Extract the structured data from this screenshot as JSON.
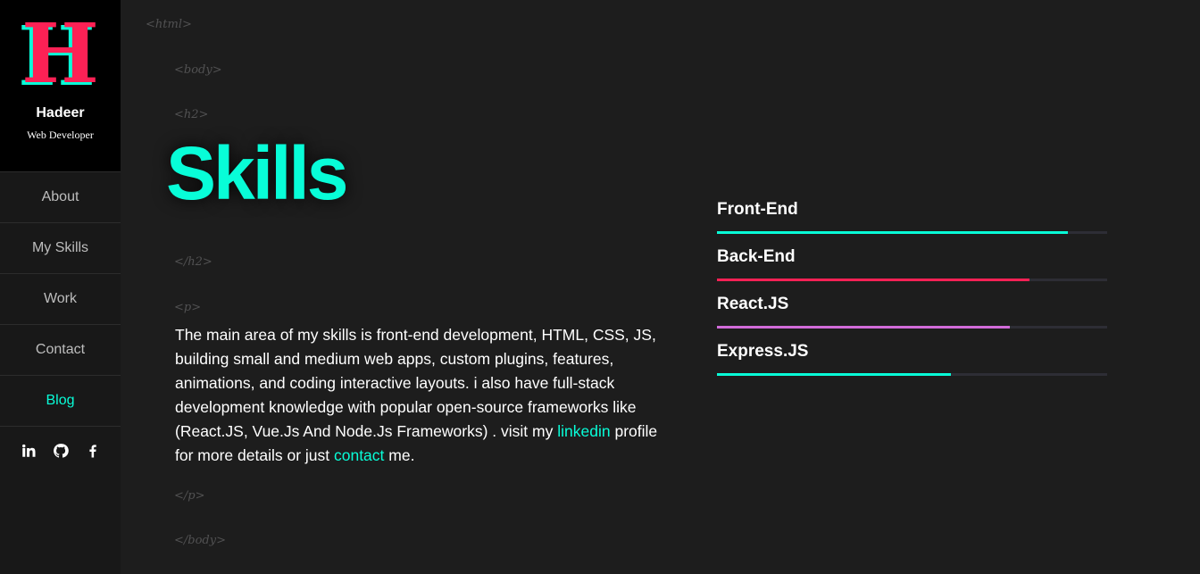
{
  "brand": {
    "letter": "H",
    "name": "Hadeer",
    "subtitle": "Web Developer"
  },
  "nav": [
    {
      "label": "About",
      "active": false
    },
    {
      "label": "My Skills",
      "active": false
    },
    {
      "label": "Work",
      "active": false
    },
    {
      "label": "Contact",
      "active": false
    },
    {
      "label": "Blog",
      "active": true
    }
  ],
  "socials": [
    {
      "icon": "linkedin-icon"
    },
    {
      "icon": "github-icon"
    },
    {
      "icon": "facebook-icon"
    }
  ],
  "tags": {
    "html_open": "<html>",
    "body_open": "<body>",
    "h2_open": "<h2>",
    "h2_close": "</h2>",
    "p_open": "<p>",
    "p_close": "</p>",
    "body_close": "</body>"
  },
  "heading": "Skills",
  "intro": {
    "text_before": "The main area of my skills is front-end development, HTML, CSS, JS, building small and medium web apps, custom plugins, features, animations, and coding interactive layouts. i also have full-stack development knowledge with popular open-source frameworks like (React.JS, Vue.Js And Node.Js Frameworks) . visit my ",
    "linkedin_label": "linkedin",
    "text_middle": " profile for more details or just ",
    "contact_label": "contact",
    "text_after": " me."
  },
  "skills": [
    {
      "name": "Front-End",
      "level": 0.9,
      "color": "#08fdd8"
    },
    {
      "name": "Back-End",
      "level": 0.8,
      "color": "#fd2155"
    },
    {
      "name": "React.JS",
      "level": 0.75,
      "color": "#d16bd9"
    },
    {
      "name": "Express.JS",
      "level": 0.6,
      "color": "#08fdd8"
    }
  ],
  "colors": {
    "accent": "#08fdd8",
    "brand": "#fd2155",
    "background": "#1d1d1d"
  }
}
